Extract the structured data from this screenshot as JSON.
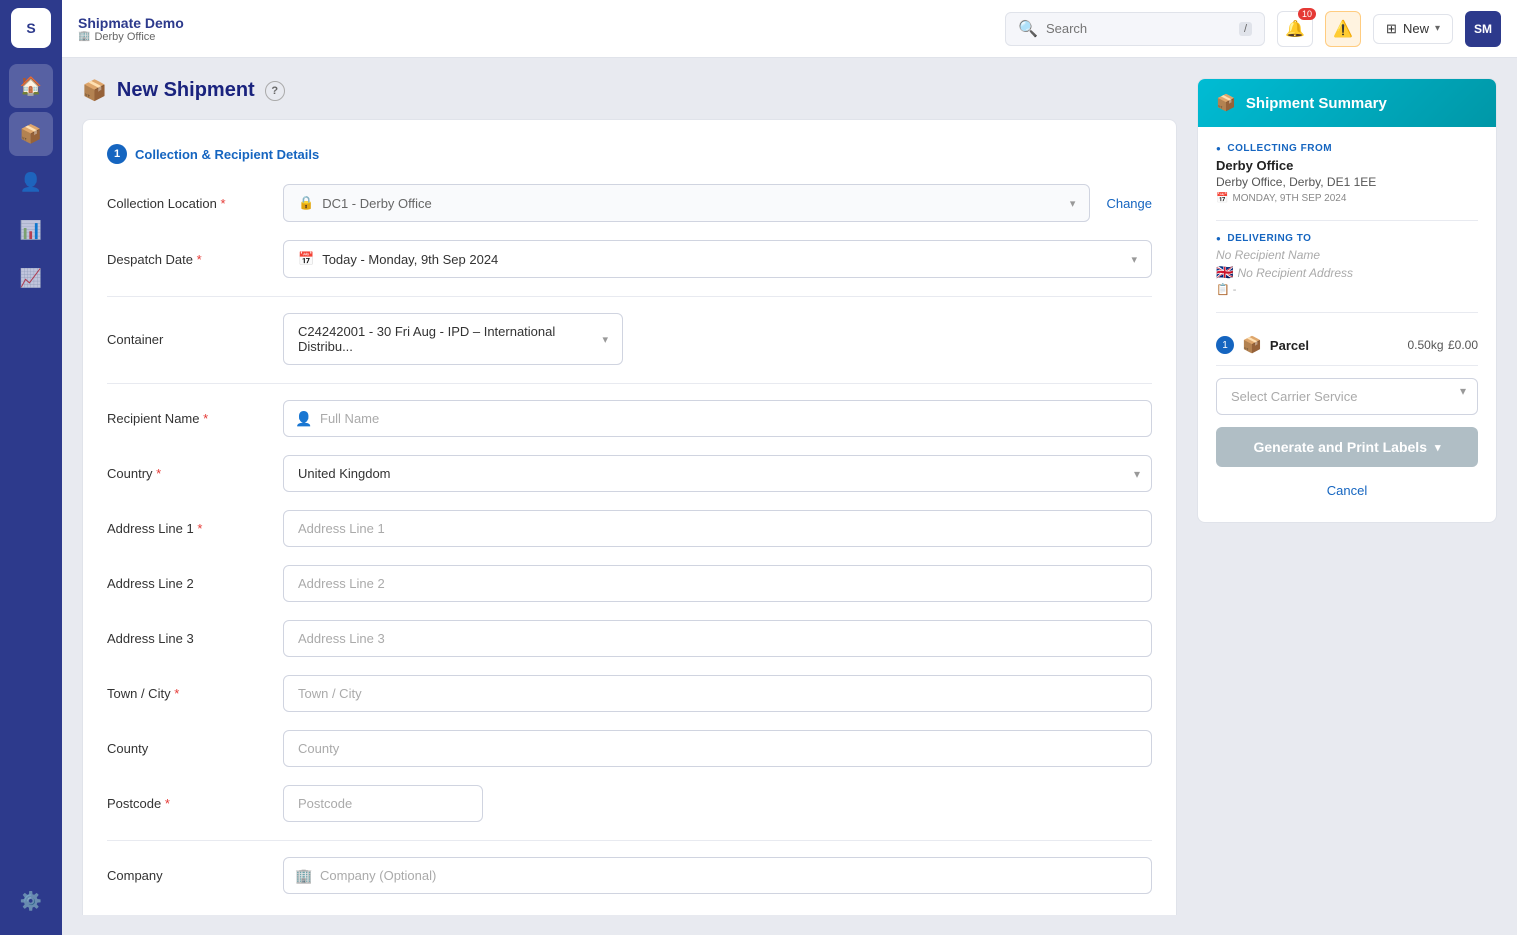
{
  "app": {
    "logo": "S",
    "brand": "Shipmate Demo",
    "branch": "Derby Office"
  },
  "topbar": {
    "search_placeholder": "Search",
    "search_kbd": "/",
    "notification_badge": "10",
    "new_label": "New"
  },
  "sidebar": {
    "items": [
      {
        "icon": "🏠",
        "name": "home",
        "active": false
      },
      {
        "icon": "📦",
        "name": "shipments",
        "active": true
      },
      {
        "icon": "👤",
        "name": "contacts",
        "active": false
      },
      {
        "icon": "📊",
        "name": "reports",
        "active": false
      },
      {
        "icon": "📈",
        "name": "analytics",
        "active": false
      }
    ],
    "bottom": [
      {
        "icon": "⚙️",
        "name": "settings",
        "active": false
      }
    ]
  },
  "page": {
    "title": "New Shipment"
  },
  "form": {
    "section1_title": "Collection & Recipient Details",
    "section1_num": "1",
    "collection_location_label": "Collection Location",
    "collection_location_value": "DC1 - Derby Office",
    "change_btn": "Change",
    "despatch_date_label": "Despatch Date",
    "despatch_date_value": "Today - Monday, 9th Sep 2024",
    "container_label": "Container",
    "container_value": "C24242001 - 30 Fri Aug - IPD – International Distribu...",
    "recipient_name_label": "Recipient Name",
    "recipient_name_placeholder": "Full Name",
    "country_label": "Country",
    "country_value": "United Kingdom",
    "address1_label": "Address Line 1",
    "address1_placeholder": "Address Line 1",
    "address2_label": "Address Line 2",
    "address2_placeholder": "Address Line 2",
    "address3_label": "Address Line 3",
    "address3_placeholder": "Address Line 3",
    "town_label": "Town / City",
    "town_placeholder": "Town / City",
    "county_label": "County",
    "county_placeholder": "County",
    "postcode_label": "Postcode",
    "postcode_placeholder": "Postcode",
    "company_label": "Company",
    "company_placeholder": "Company (Optional)"
  },
  "summary": {
    "title": "Shipment Summary",
    "collecting_from_label": "COLLECTING FROM",
    "collecting_from_name": "Derby Office",
    "collecting_from_address": "Derby Office, Derby, DE1 1EE",
    "collecting_from_date": "MONDAY, 9TH SEP 2024",
    "delivering_to_label": "DELIVERING TO",
    "delivering_to_name": "No Recipient Name",
    "delivering_to_address": "No Recipient Address",
    "parcel_label": "Parcel",
    "parcel_num": "1",
    "parcel_weight": "0.50kg",
    "parcel_price": "£0.00",
    "carrier_placeholder": "Select Carrier Service",
    "generate_label": "Generate and Print Labels",
    "cancel_label": "Cancel"
  }
}
